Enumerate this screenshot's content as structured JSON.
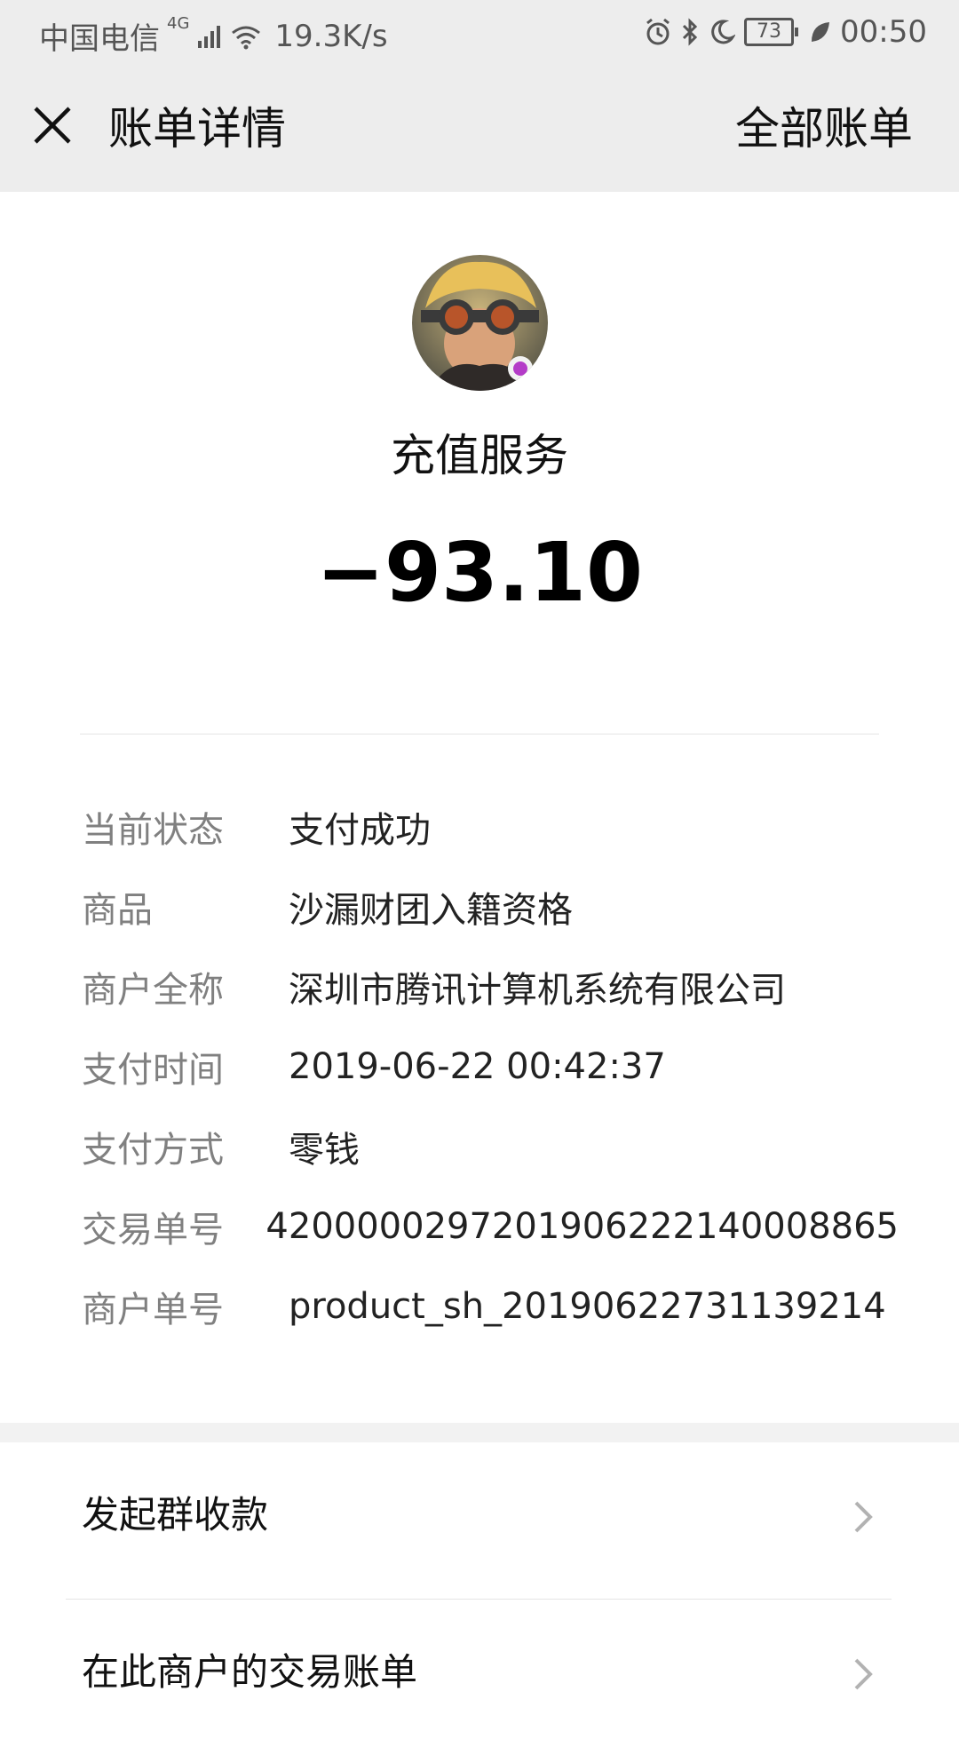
{
  "status_bar": {
    "carrier": "中国电信",
    "network_type": "4G",
    "speed": "19.3K/s",
    "battery": "73",
    "time": "00:50",
    "icons": [
      "signal-icon",
      "wifi-icon",
      "alarm-icon",
      "bluetooth-icon",
      "moon-icon",
      "battery-icon",
      "leaf-icon"
    ]
  },
  "header": {
    "title": "账单详情",
    "action_label": "全部账单",
    "close_icon": "close-icon"
  },
  "summary": {
    "merchant_name": "充值服务",
    "amount": "−93.10"
  },
  "details": [
    {
      "label": "当前状态",
      "value": "支付成功"
    },
    {
      "label": "商品",
      "value": "沙漏财团入籍资格"
    },
    {
      "label": "商户全称",
      "value": "深圳市腾讯计算机系统有限公司"
    },
    {
      "label": "支付时间",
      "value": "2019-06-22 00:42:37"
    },
    {
      "label": "支付方式",
      "value": "零钱"
    },
    {
      "label": "交易单号",
      "value": "4200000297201906222140008865"
    },
    {
      "label": "商户单号",
      "value": "product_sh_20190622731139214"
    }
  ],
  "actions": [
    {
      "label": "发起群收款"
    },
    {
      "label": "在此商户的交易账单"
    }
  ],
  "colors": {
    "header_bg": "#ededed",
    "label_gray": "#808080",
    "text_dark": "#111111"
  }
}
